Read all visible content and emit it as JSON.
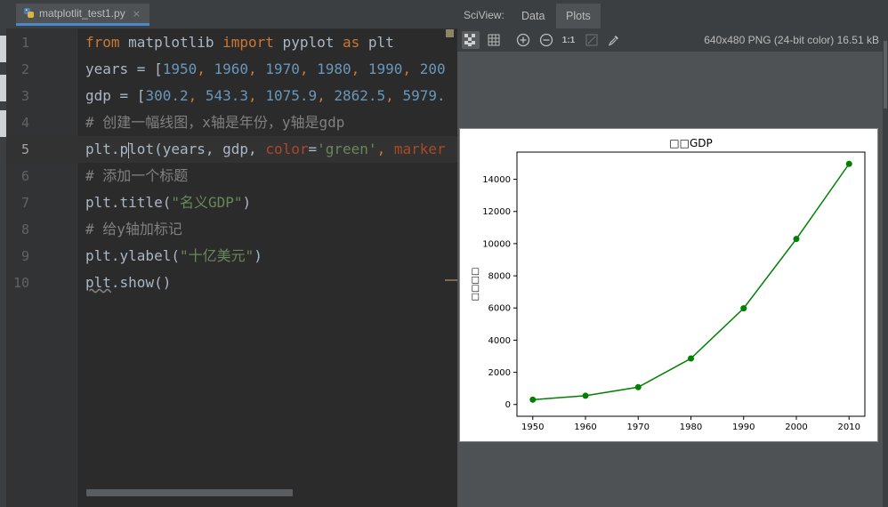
{
  "editor": {
    "tab_label": "matplotlit_test1.py",
    "tab_close": "×",
    "line_numbers": [
      "1",
      "2",
      "3",
      "4",
      "5",
      "6",
      "7",
      "8",
      "9",
      "10"
    ]
  },
  "code": {
    "l1_kw1": "from",
    "l1_mod": " matplotlib ",
    "l1_kw2": "import",
    "l1_mid": " pyplot ",
    "l1_kw3": "as",
    "l1_end": " plt",
    "l2_pre": "years = [",
    "l2_n1": "1950",
    "l2_n2": "1960",
    "l2_n3": "1970",
    "l2_n4": "1980",
    "l2_n5": "1990",
    "l2_n6": "200",
    "l3_pre": "gdp = [",
    "l3_n1": "300.2",
    "l3_n2": "543.3",
    "l3_n3": "1075.9",
    "l3_n4": "2862.5",
    "l3_n5": "5979.",
    "l4": "# 创建一幅线图，x轴是年份，y轴是gdp",
    "l5_a": "plt.p",
    "l5_b": "lot",
    "l5_c": "(years, gdp, ",
    "l5_p1": "color",
    "l5_eq": "=",
    "l5_s1": "'green'",
    "l5_cm": ", ",
    "l5_p2": "marker",
    "l6": "# 添加一个标题",
    "l7_a": "plt.title(",
    "l7_s": "\"名义GDP\"",
    "l7_b": ")",
    "l8": "# 给y轴加标记",
    "l9_a": "plt.ylabel(",
    "l9_s": "\"十亿美元\"",
    "l9_b": ")",
    "l10_a": "plt",
    "l10_b": ".show()",
    "comma": ", "
  },
  "sciview": {
    "title": "SciView:",
    "tabs": [
      "Data",
      "Plots"
    ],
    "image_info": "640x480 PNG (24-bit color) 16.51 kB",
    "zoom_reset_label": "1:1"
  },
  "chart_data": {
    "type": "line",
    "title": "□□GDP",
    "ylabel": "□□□□",
    "xlabel": "",
    "x": [
      1950,
      1960,
      1970,
      1980,
      1990,
      2000,
      2010
    ],
    "series": [
      {
        "values": [
          300.2,
          543.3,
          1075.9,
          2862.5,
          5979.6,
          10289.7,
          14958.3
        ],
        "color": "#008000",
        "marker": "o"
      }
    ],
    "xticks": [
      "1950",
      "1960",
      "1970",
      "1980",
      "1990",
      "2000",
      "2010"
    ],
    "yticks": [
      "0",
      "2000",
      "4000",
      "6000",
      "8000",
      "10000",
      "12000",
      "14000"
    ],
    "xlim": [
      1947,
      2013
    ],
    "ylim": [
      -733,
      15691
    ]
  }
}
